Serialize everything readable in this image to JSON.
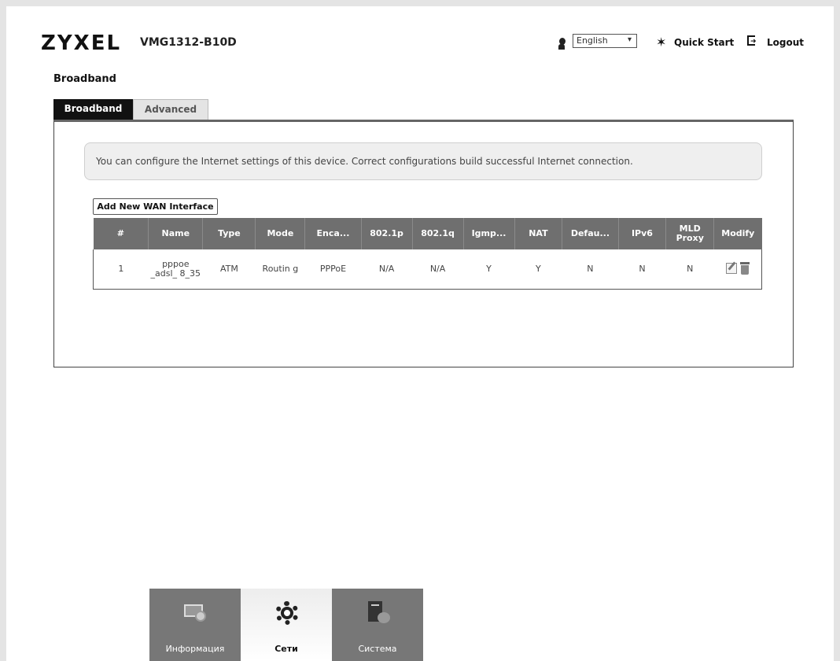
{
  "header": {
    "brand": "ZYXEL",
    "model": "VMG1312-B10D",
    "language": "English",
    "quick_start": "Quick Start",
    "logout": "Logout"
  },
  "page": {
    "title": "Broadband",
    "tabs": [
      {
        "label": "Broadband",
        "active": true
      },
      {
        "label": "Advanced",
        "active": false
      }
    ],
    "info": "You can configure the Internet settings of this device. Correct configurations build successful Internet connection.",
    "add_button": "Add New WAN Interface"
  },
  "table": {
    "headers": [
      "#",
      "Name",
      "Type",
      "Mode",
      "Enca...",
      "802.1p",
      "802.1q",
      "Igmp...",
      "NAT",
      "Defau...",
      "IPv6",
      "MLD Proxy",
      "Modify"
    ],
    "rows": [
      {
        "num": "1",
        "name": "pppoe _adsl_ 8_35",
        "type": "ATM",
        "mode": "Routin g",
        "enca": "PPPoE",
        "p8021p": "N/A",
        "p8021q": "N/A",
        "igmp": "Y",
        "nat": "Y",
        "default": "N",
        "ipv6": "N",
        "mld": "N"
      }
    ]
  },
  "bottom_nav": [
    {
      "label": "Информация",
      "icon": "monitor-icon",
      "active": false
    },
    {
      "label": "Сети",
      "icon": "gear-icon",
      "active": true
    },
    {
      "label": "Система",
      "icon": "system-icon",
      "active": false
    }
  ]
}
